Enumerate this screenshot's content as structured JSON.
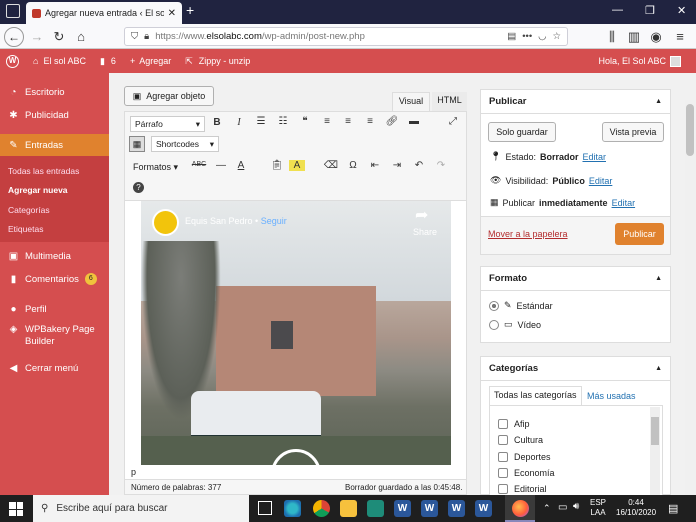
{
  "browser": {
    "tab_title": "Agregar nueva entrada ‹ El sol ABC",
    "url_prefix": "https://www.",
    "url_domain": "elsolabc.com",
    "url_path": "/wp-admin/post-new.php"
  },
  "adminbar": {
    "site": "El sol ABC",
    "comments": "6",
    "new": "Agregar",
    "plugin": "Zippy - unzip",
    "greeting": "Hola, El Sol ABC"
  },
  "sidebar": {
    "items": [
      {
        "label": "Escritorio",
        "icon": "gauge-icon"
      },
      {
        "label": "Publicidad",
        "icon": "megaphone-icon"
      },
      {
        "label": "Entradas",
        "icon": "pushpin-icon"
      },
      {
        "label": "Multimedia",
        "icon": "media-icon"
      },
      {
        "label": "Comentarios",
        "icon": "comment-icon",
        "badge": "6"
      },
      {
        "label": "Perfil",
        "icon": "user-icon"
      },
      {
        "label": "WPBakery Page Builder",
        "icon": "builder-icon"
      },
      {
        "label": "Cerrar menú",
        "icon": "collapse-icon"
      }
    ],
    "submenu": [
      "Todas las entradas",
      "Agregar nueva",
      "Categorías",
      "Etiquetas"
    ]
  },
  "editor": {
    "add_media": "Agregar objeto",
    "tab_visual": "Visual",
    "tab_html": "HTML",
    "format_select": "Párrafo",
    "shortcodes_select": "Shortcodes",
    "formats_menu": "Formatos",
    "video_channel": "Equis San Pedro •",
    "video_follow": "Seguir",
    "video_share": "Share",
    "paragraph_path": "p",
    "word_count": "Número de palabras: 377",
    "draft_saved": "Borrador guardado a las 0:45:48."
  },
  "publish": {
    "title": "Publicar",
    "save_draft": "Solo guardar",
    "preview": "Vista previa",
    "status_label": "Estado:",
    "status_value": "Borrador",
    "visibility_label": "Visibilidad:",
    "visibility_value": "Público",
    "schedule_label": "Publicar",
    "schedule_value": "inmediatamente",
    "edit": "Editar",
    "trash": "Mover a la papelera",
    "publish_button": "Publicar"
  },
  "format": {
    "title": "Formato",
    "options": [
      "Estándar",
      "Vídeo"
    ],
    "selected": 0
  },
  "categories": {
    "title": "Categorías",
    "tab_all": "Todas las categorías",
    "tab_used": "Más usadas",
    "items": [
      "Afip",
      "Cultura",
      "Deportes",
      "Economía",
      "Editorial"
    ]
  },
  "taskbar": {
    "search": "Escribe aquí para buscar",
    "lang": "ESP",
    "layout": "LAA",
    "time": "0:44",
    "date": "16/10/2020"
  },
  "colors": {
    "wp_red": "#d54e4f",
    "publish_orange": "#e0822e",
    "link_blue": "#2271b1"
  }
}
